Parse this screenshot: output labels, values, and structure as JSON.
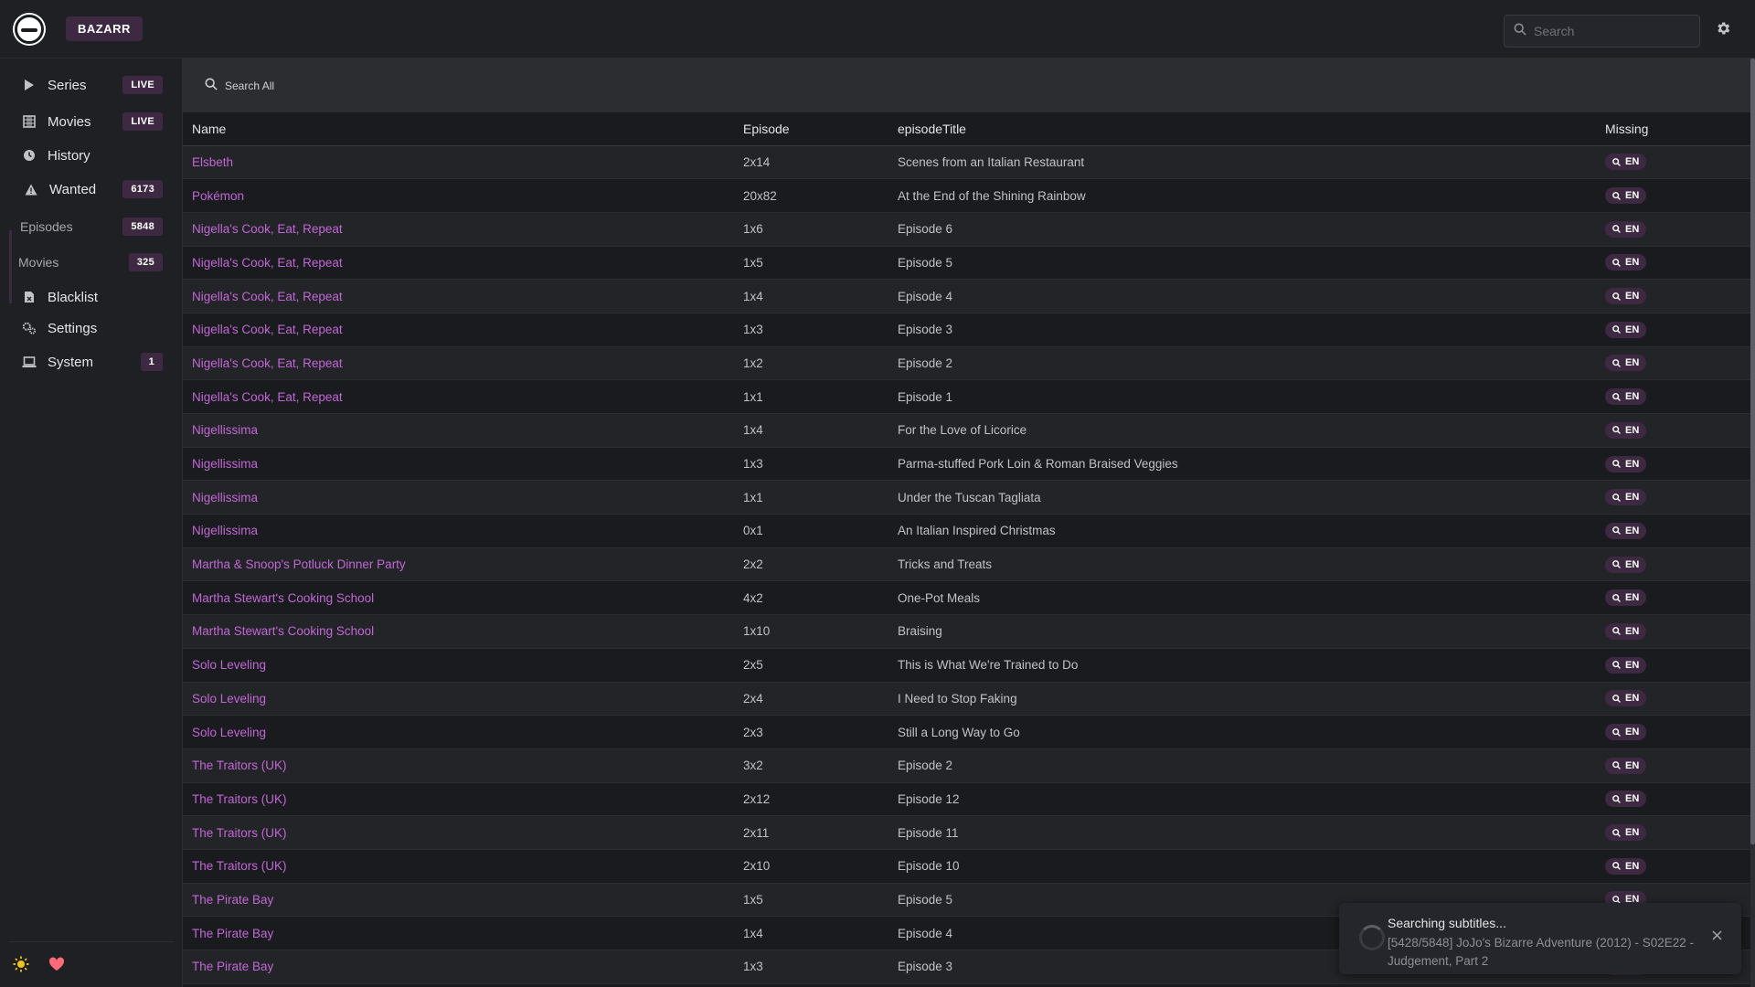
{
  "header": {
    "brand": "BAZARR",
    "search_placeholder": "Search"
  },
  "sidebar": {
    "items": [
      {
        "label": "Series",
        "badge": "LIVE",
        "icon": "play-icon"
      },
      {
        "label": "Movies",
        "badge": "LIVE",
        "icon": "film-icon"
      },
      {
        "label": "History",
        "badge": "",
        "icon": "clock-icon"
      },
      {
        "label": "Wanted",
        "badge": "6173",
        "icon": "warning-icon"
      },
      {
        "label": "Episodes",
        "badge": "5848",
        "icon": ""
      },
      {
        "label": "Movies",
        "badge": "325",
        "icon": ""
      },
      {
        "label": "Blacklist",
        "badge": "",
        "icon": "file-x-icon"
      },
      {
        "label": "Settings",
        "badge": "",
        "icon": "gears-icon"
      },
      {
        "label": "System",
        "badge": "1",
        "icon": "laptop-icon"
      }
    ]
  },
  "toolbar": {
    "search_all": "Search All"
  },
  "table": {
    "headers": [
      "Name",
      "Episode",
      "episodeTitle",
      "Missing"
    ],
    "missing_label": "EN",
    "rows": [
      [
        "Elsbeth",
        "2x14",
        "Scenes from an Italian Restaurant"
      ],
      [
        "Pokémon",
        "20x82",
        "At the End of the Shining Rainbow"
      ],
      [
        "Nigella's Cook, Eat, Repeat",
        "1x6",
        "Episode 6"
      ],
      [
        "Nigella's Cook, Eat, Repeat",
        "1x5",
        "Episode 5"
      ],
      [
        "Nigella's Cook, Eat, Repeat",
        "1x4",
        "Episode 4"
      ],
      [
        "Nigella's Cook, Eat, Repeat",
        "1x3",
        "Episode 3"
      ],
      [
        "Nigella's Cook, Eat, Repeat",
        "1x2",
        "Episode 2"
      ],
      [
        "Nigella's Cook, Eat, Repeat",
        "1x1",
        "Episode 1"
      ],
      [
        "Nigellissima",
        "1x4",
        "For the Love of Licorice"
      ],
      [
        "Nigellissima",
        "1x3",
        "Parma-stuffed Pork Loin & Roman Braised Veggies"
      ],
      [
        "Nigellissima",
        "1x1",
        "Under the Tuscan Tagliata"
      ],
      [
        "Nigellissima",
        "0x1",
        "An Italian Inspired Christmas"
      ],
      [
        "Martha & Snoop's Potluck Dinner Party",
        "2x2",
        "Tricks and Treats"
      ],
      [
        "Martha Stewart's Cooking School",
        "4x2",
        "One-Pot Meals"
      ],
      [
        "Martha Stewart's Cooking School",
        "1x10",
        "Braising"
      ],
      [
        "Solo Leveling",
        "2x5",
        "This is What We're Trained to Do"
      ],
      [
        "Solo Leveling",
        "2x4",
        "I Need to Stop Faking"
      ],
      [
        "Solo Leveling",
        "2x3",
        "Still a Long Way to Go"
      ],
      [
        "The Traitors (UK)",
        "3x2",
        "Episode 2"
      ],
      [
        "The Traitors (UK)",
        "2x12",
        "Episode 12"
      ],
      [
        "The Traitors (UK)",
        "2x11",
        "Episode 11"
      ],
      [
        "The Traitors (UK)",
        "2x10",
        "Episode 10"
      ],
      [
        "The Pirate Bay",
        "1x5",
        "Episode 5"
      ],
      [
        "The Pirate Bay",
        "1x4",
        "Episode 4"
      ],
      [
        "The Pirate Bay",
        "1x3",
        "Episode 3"
      ]
    ]
  },
  "toast": {
    "title": "Searching subtitles...",
    "message": "[5428/5848] JoJo's Bizarre Adventure (2012) - S02E22 - Judgement, Part 2"
  },
  "colors": {
    "accent": "#c167d5",
    "badge_bg": "#3d2a42",
    "sun_icon": "#f0c419",
    "heart_icon": "#ff6b7a"
  }
}
